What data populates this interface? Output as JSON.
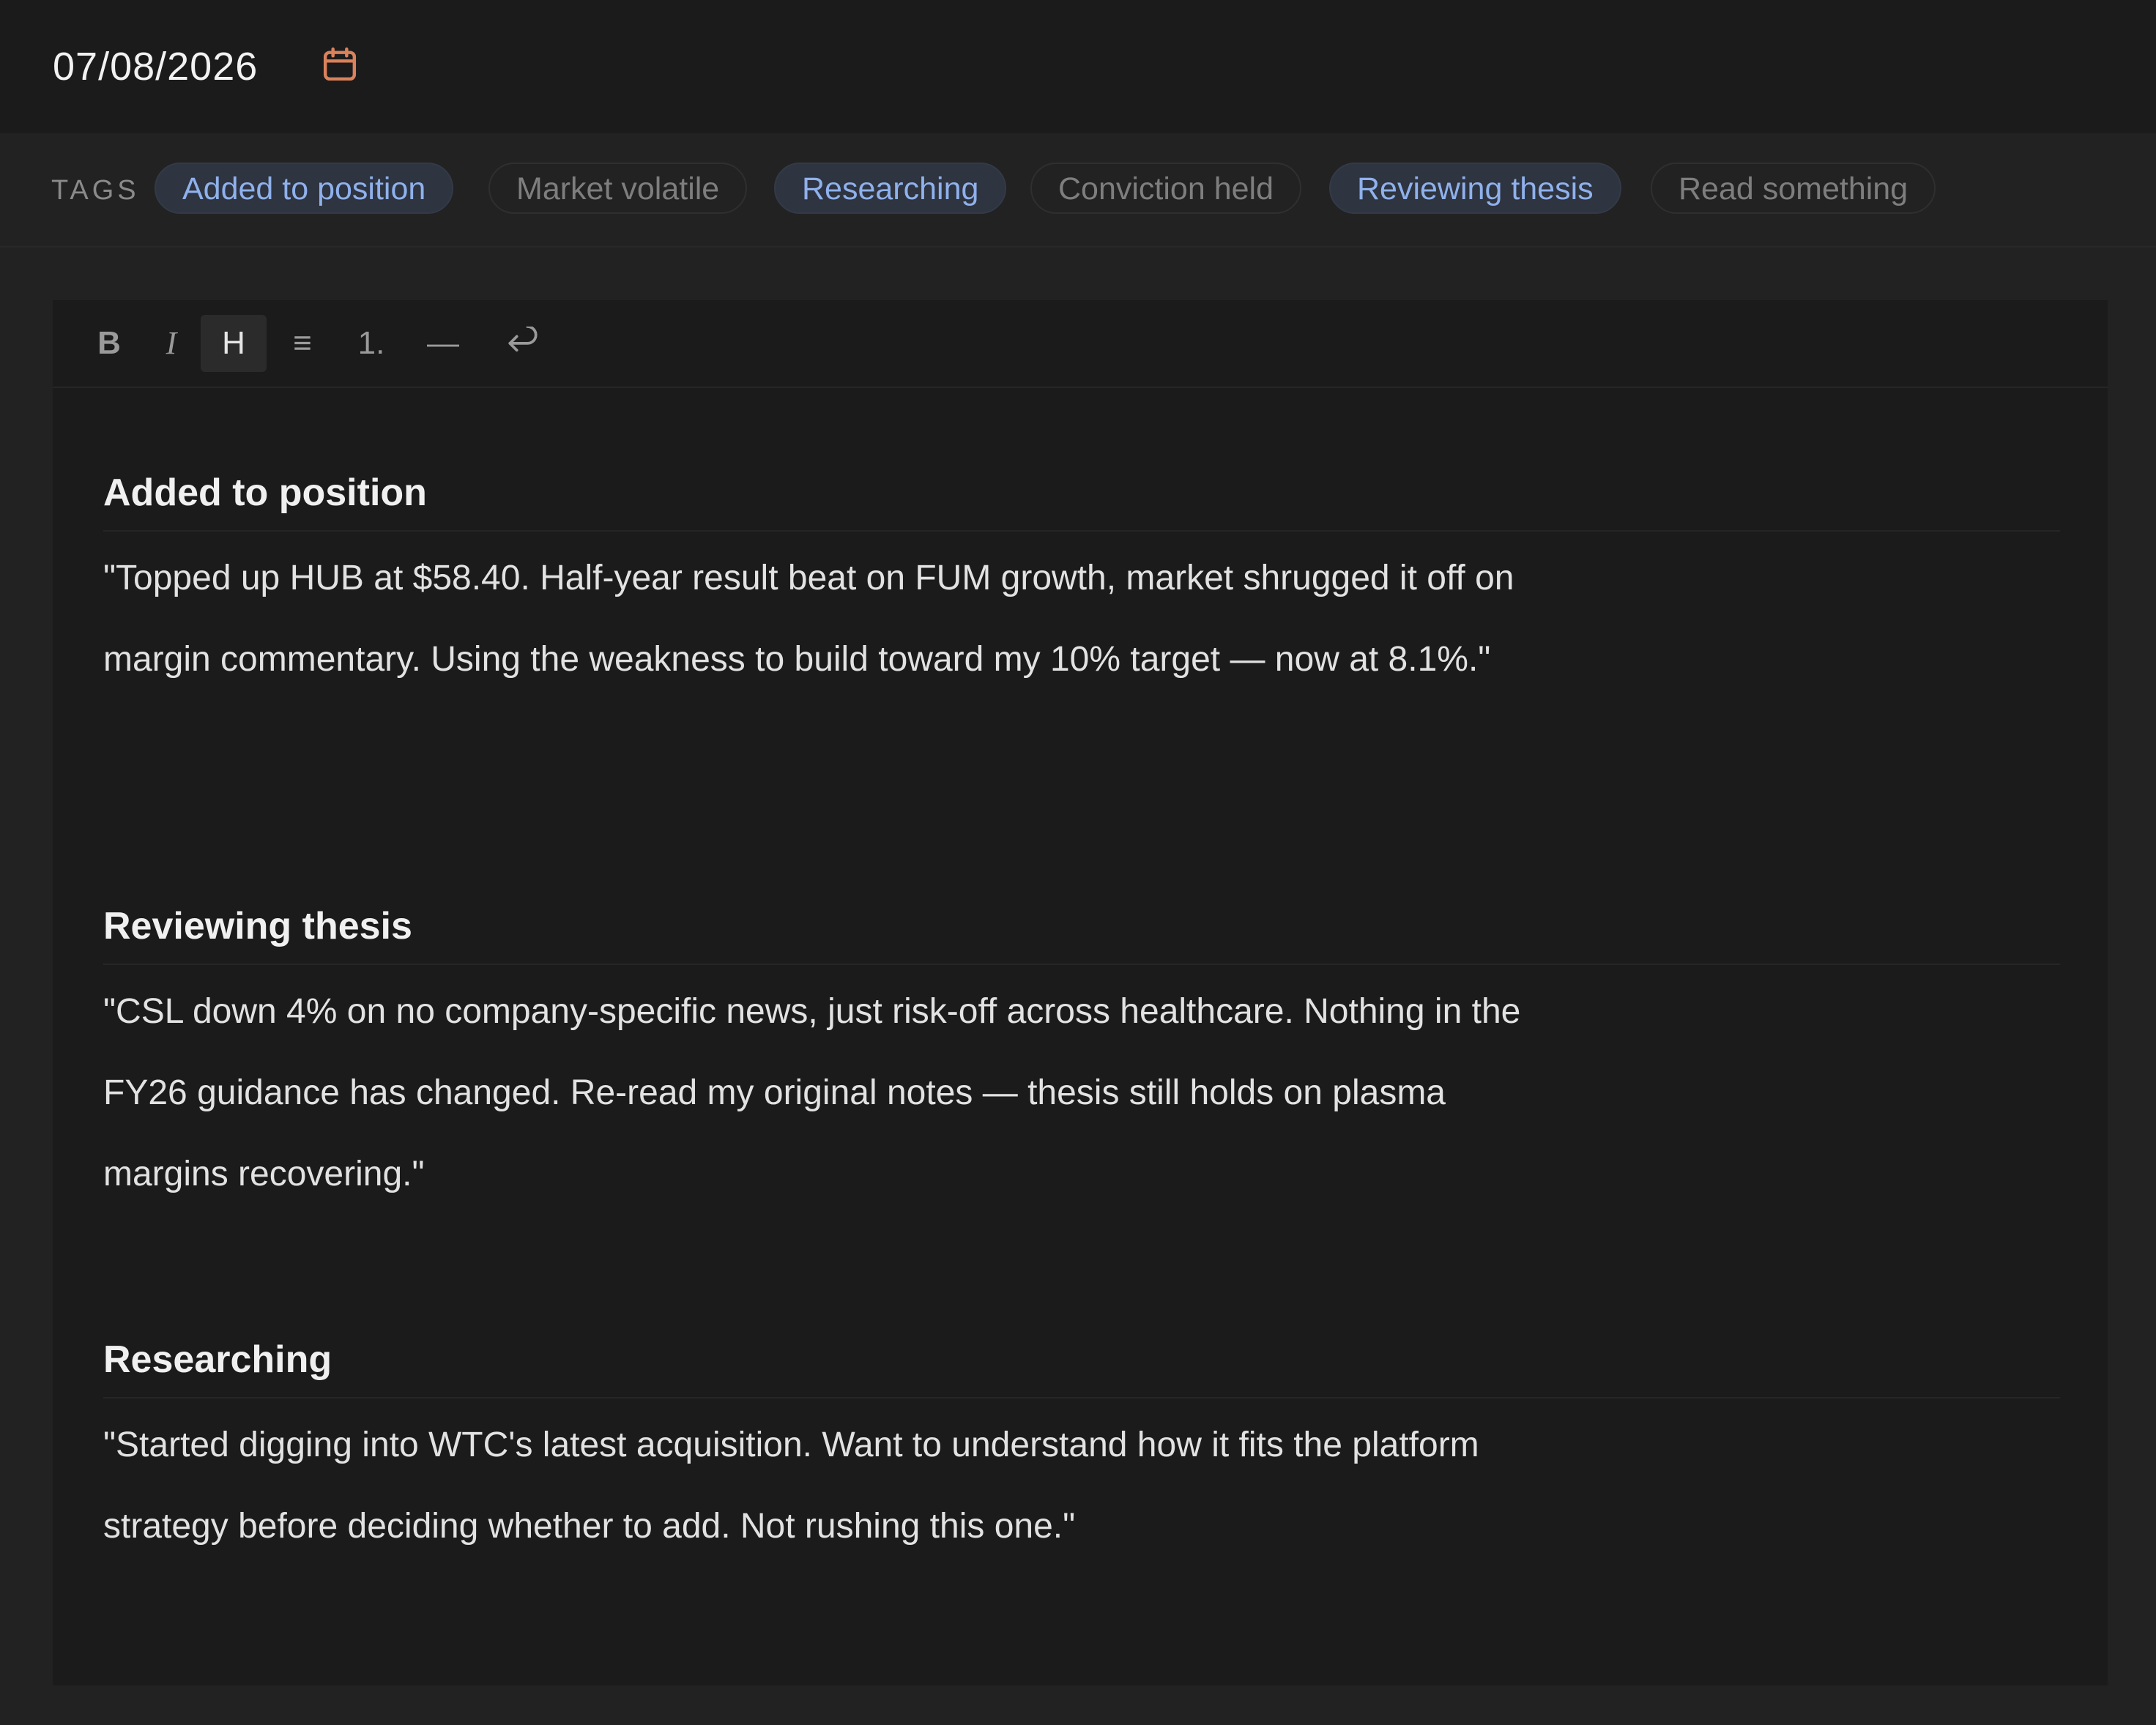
{
  "header": {
    "date": "07/08/2026",
    "calendar_color": "#d9825b"
  },
  "tags": {
    "label": "TAGS",
    "items": [
      {
        "label": "Added to position",
        "active": true
      },
      {
        "label": "Market volatile",
        "active": false
      },
      {
        "label": "Researching",
        "active": true
      },
      {
        "label": "Conviction held",
        "active": false
      },
      {
        "label": "Reviewing thesis",
        "active": true
      },
      {
        "label": "Read something",
        "active": false
      }
    ]
  },
  "toolbar": {
    "bold": "B",
    "italic": "I",
    "heading": "H",
    "bullet_list": "≡",
    "ordered_list": "1.",
    "rule": "—"
  },
  "entries": [
    {
      "title": "Added to position",
      "body": "\"Topped up HUB at $58.40. Half-year result beat on FUM growth, market shrugged it off on margin commentary. Using the weakness to build toward my 10% target — now at 8.1%.\""
    },
    {
      "title": "Reviewing thesis",
      "body": "\"CSL down 4% on no company-specific news, just risk-off across healthcare. Nothing in the FY26 guidance has changed. Re-read my original notes — thesis still holds on plasma margins recovering.\""
    },
    {
      "title": "Researching",
      "body": "\"Started digging into WTC's latest acquisition. Want to understand how it fits the platform strategy before deciding whether to add. Not rushing this one.\""
    }
  ]
}
